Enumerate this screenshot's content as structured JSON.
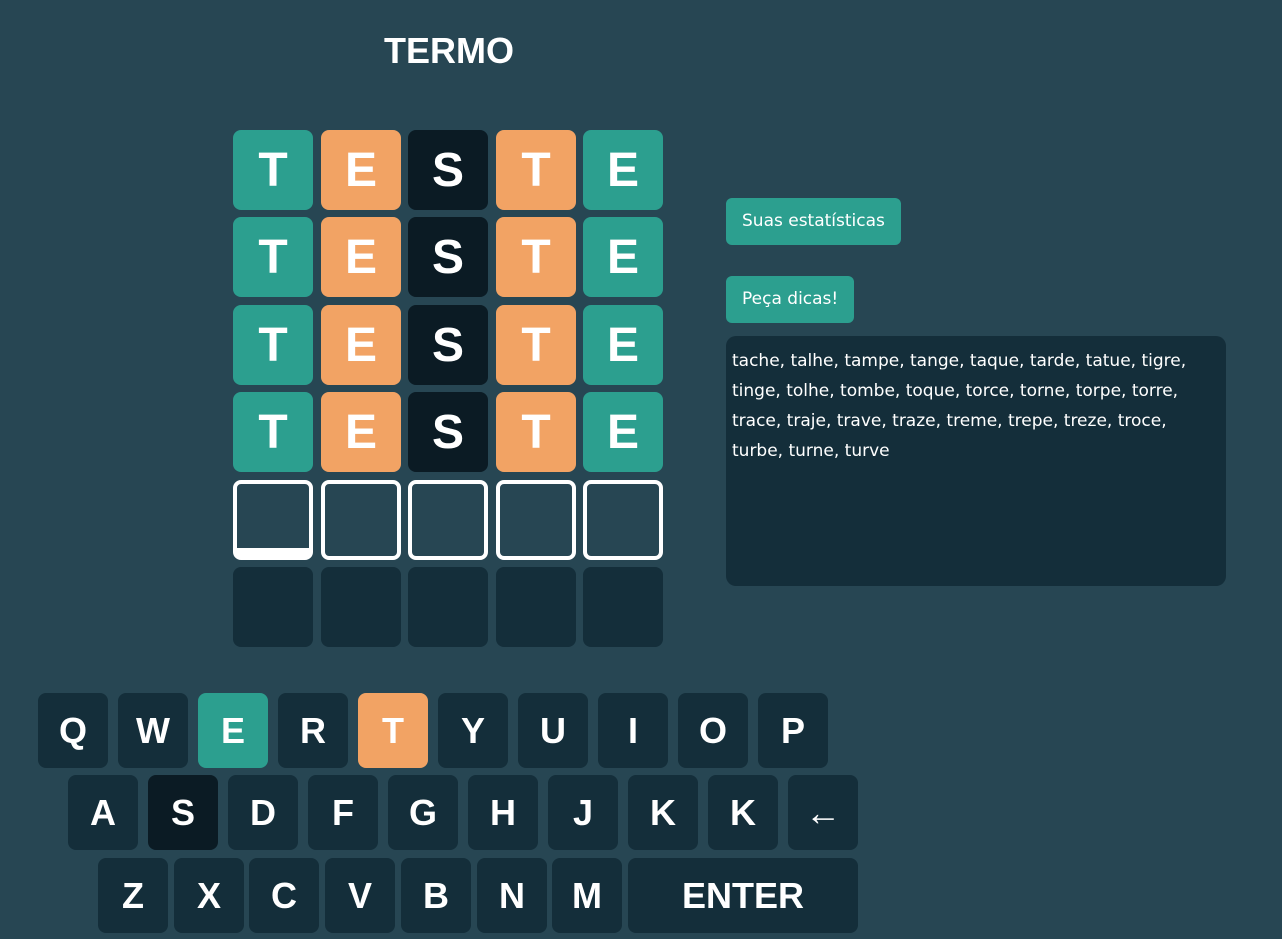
{
  "title": "TERMO",
  "colors": {
    "background": "#274653",
    "right": "#2c9f8f",
    "place": "#f2a364",
    "wrong": "#0b1b24",
    "empty": "#142e3a",
    "edit_border": "#ffffff"
  },
  "board": {
    "rows": [
      {
        "state": "submitted",
        "letters": [
          "T",
          "E",
          "S",
          "T",
          "E"
        ],
        "status": [
          "right",
          "place",
          "wrong",
          "place",
          "right"
        ]
      },
      {
        "state": "submitted",
        "letters": [
          "T",
          "E",
          "S",
          "T",
          "E"
        ],
        "status": [
          "right",
          "place",
          "wrong",
          "place",
          "right"
        ]
      },
      {
        "state": "submitted",
        "letters": [
          "T",
          "E",
          "S",
          "T",
          "E"
        ],
        "status": [
          "right",
          "place",
          "wrong",
          "place",
          "right"
        ]
      },
      {
        "state": "submitted",
        "letters": [
          "T",
          "E",
          "S",
          "T",
          "E"
        ],
        "status": [
          "right",
          "place",
          "wrong",
          "place",
          "right"
        ]
      },
      {
        "state": "editing",
        "letters": [
          "",
          "",
          "",
          "",
          ""
        ],
        "status": [
          "edit",
          "edit",
          "edit",
          "edit",
          "edit"
        ],
        "active_column": 1
      },
      {
        "state": "empty",
        "letters": [
          "",
          "",
          "",
          "",
          ""
        ],
        "status": [
          "empty",
          "empty",
          "empty",
          "empty",
          "empty"
        ]
      }
    ]
  },
  "actions": {
    "stats_label": "Suas estatísticas",
    "hints_label": "Peça dicas!"
  },
  "hints": {
    "text": "tache, talhe, tampe, tange, taque, tarde, tatue, tigre, tinge, tolhe, tombe, toque, torce, torne, torpe, torre, trace, traje, trave, traze, treme, trepe, treze, troce, turbe, turne, turve"
  },
  "keyboard": {
    "rows": [
      [
        {
          "label": "Q",
          "status": "unused"
        },
        {
          "label": "W",
          "status": "unused"
        },
        {
          "label": "E",
          "status": "right"
        },
        {
          "label": "R",
          "status": "unused"
        },
        {
          "label": "T",
          "status": "place"
        },
        {
          "label": "Y",
          "status": "unused"
        },
        {
          "label": "U",
          "status": "unused"
        },
        {
          "label": "I",
          "status": "unused"
        },
        {
          "label": "O",
          "status": "unused"
        },
        {
          "label": "P",
          "status": "unused"
        }
      ],
      [
        {
          "label": "A",
          "status": "unused"
        },
        {
          "label": "S",
          "status": "wrong"
        },
        {
          "label": "D",
          "status": "unused"
        },
        {
          "label": "F",
          "status": "unused"
        },
        {
          "label": "G",
          "status": "unused"
        },
        {
          "label": "H",
          "status": "unused"
        },
        {
          "label": "J",
          "status": "unused"
        },
        {
          "label": "K",
          "status": "unused"
        },
        {
          "label": "K",
          "status": "unused"
        },
        {
          "label": "←",
          "status": "unused"
        }
      ],
      [
        {
          "label": "Z",
          "status": "unused"
        },
        {
          "label": "X",
          "status": "unused"
        },
        {
          "label": "C",
          "status": "unused"
        },
        {
          "label": "V",
          "status": "unused"
        },
        {
          "label": "B",
          "status": "unused"
        },
        {
          "label": "N",
          "status": "unused"
        },
        {
          "label": "M",
          "status": "unused"
        },
        {
          "label": "ENTER",
          "status": "unused"
        }
      ]
    ]
  }
}
